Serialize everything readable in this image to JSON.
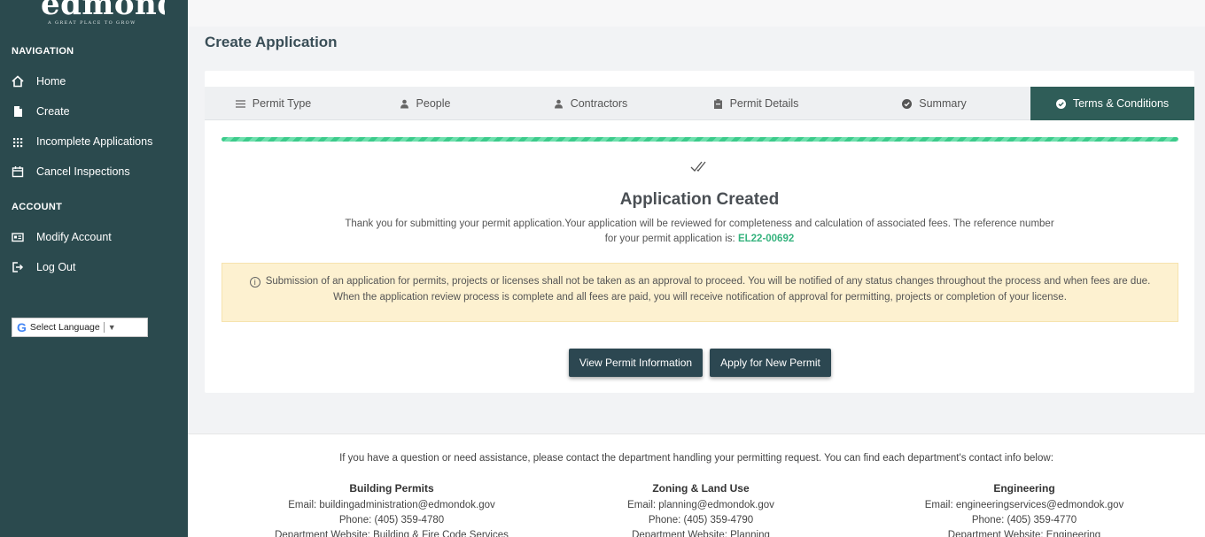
{
  "sidebar": {
    "logo_text": "edmond",
    "logo_tagline": "A GREAT PLACE TO GROW",
    "nav_header": "NAVIGATION",
    "nav_items": [
      {
        "label": "Home",
        "icon": "home-icon"
      },
      {
        "label": "Create",
        "icon": "file-icon"
      },
      {
        "label": "Incomplete Applications",
        "icon": "grid-icon"
      },
      {
        "label": "Cancel Inspections",
        "icon": "calendar-icon"
      }
    ],
    "account_header": "ACCOUNT",
    "account_items": [
      {
        "label": "Modify Account",
        "icon": "id-card-icon"
      },
      {
        "label": "Log Out",
        "icon": "logout-icon"
      }
    ],
    "translate_label": "Select Language",
    "translate_arrow": "▼"
  },
  "page": {
    "title": "Create Application"
  },
  "tabs": [
    {
      "label": "Permit Type",
      "icon": "list-icon",
      "active": false
    },
    {
      "label": "People",
      "icon": "person-icon",
      "active": false
    },
    {
      "label": "Contractors",
      "icon": "person-icon",
      "active": false
    },
    {
      "label": "Permit Details",
      "icon": "clipboard-icon",
      "active": false
    },
    {
      "label": "Summary",
      "icon": "check-circle-icon",
      "active": false
    },
    {
      "label": "Terms & Conditions",
      "icon": "check-circle-icon",
      "active": true
    }
  ],
  "progress": 1.0,
  "result": {
    "title": "Application Created",
    "message_1": "Thank you for submitting your permit application.Your application will be reviewed for completeness and calculation of associated fees. The reference number",
    "message_2": "for your permit application is:",
    "reference": "EL22-00692"
  },
  "notice": {
    "icon_glyph": "i",
    "line_1": "Submission of an application for permits, projects or licenses shall not be taken as an approval to proceed. You will be notified of any status changes throughout the process and when fees are due.",
    "line_2": "When the application review process is complete and all fees are paid, you will receive notification of approval for permitting, projects or completion of your license."
  },
  "buttons": {
    "view_permit": "View Permit Information",
    "apply_new": "Apply for New Permit"
  },
  "footer": {
    "intro": "If you have a question or need assistance, please contact the department handling your permitting request. You can find each department's contact info below:",
    "departments": [
      {
        "name": "Building Permits",
        "email": "Email: buildingadministration@edmondok.gov",
        "phone": "Phone: (405) 359-4780",
        "website": "Department Website: Building & Fire Code Services"
      },
      {
        "name": "Zoning & Land Use",
        "email": "Email: planning@edmondok.gov",
        "phone": "Phone: (405) 359-4790",
        "website": "Department Website: Planning"
      },
      {
        "name": "Engineering",
        "email": "Email: engineeringservices@edmondok.gov",
        "phone": "Phone: (405) 359-4770",
        "website": "Department Website: Engineering"
      }
    ]
  }
}
